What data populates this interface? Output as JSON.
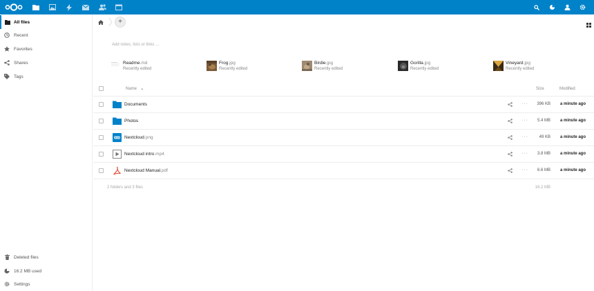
{
  "header": {
    "apps": [
      {
        "icon": "files-icon",
        "active": true
      },
      {
        "icon": "photos-icon",
        "active": false
      },
      {
        "icon": "activity-icon",
        "active": false
      },
      {
        "icon": "mail-icon",
        "active": false
      },
      {
        "icon": "contacts-icon",
        "active": false
      },
      {
        "icon": "calendar-icon",
        "active": false
      }
    ],
    "brand_color": "#0082c9"
  },
  "sidebar": {
    "items": [
      {
        "label": "All files",
        "icon": "folder-icon",
        "active": true
      },
      {
        "label": "Recent",
        "icon": "clock-icon"
      },
      {
        "label": "Favorites",
        "icon": "star-icon"
      },
      {
        "label": "Shares",
        "icon": "share-icon"
      },
      {
        "label": "Tags",
        "icon": "tag-icon"
      }
    ],
    "bottom": [
      {
        "label": "Deleted files",
        "icon": "trash-icon"
      },
      {
        "label": "16.2 MB used",
        "icon": "quota-pie-icon"
      },
      {
        "label": "Settings",
        "icon": "gear-icon"
      }
    ]
  },
  "main": {
    "add_label": "+",
    "notes_placeholder": "Add notes, lists or links …",
    "recent": [
      {
        "base": "Readme",
        "ext": ".md",
        "sub": "Recently edited"
      },
      {
        "base": "Frog",
        "ext": ".jpg",
        "sub": "Recently edited"
      },
      {
        "base": "Birdie",
        "ext": ".jpg",
        "sub": "Recently edited"
      },
      {
        "base": "Gorilla",
        "ext": ".jpg",
        "sub": "Recently edited"
      },
      {
        "base": "Vineyard",
        "ext": ".jpg",
        "sub": "Recently edited"
      }
    ],
    "table": {
      "col_name": "Name",
      "sort_indicator": "▲",
      "col_size": "Size",
      "col_modified": "Modified",
      "rows": [
        {
          "base": "Documents",
          "ext": "",
          "size": "396 KB",
          "modified": "a minute ago",
          "icon": "folder-icon"
        },
        {
          "base": "Photos",
          "ext": "",
          "size": "5.4 MB",
          "modified": "a minute ago",
          "icon": "folder-icon"
        },
        {
          "base": "Nextcloud",
          "ext": ".png",
          "size": "49 KB",
          "modified": "a minute ago",
          "icon": "image-icon"
        },
        {
          "base": "Nextcloud intro",
          "ext": ".mp4",
          "size": "3.8 MB",
          "modified": "a minute ago",
          "icon": "video-icon"
        },
        {
          "base": "Nextcloud Manual",
          "ext": ".pdf",
          "size": "6.6 MB",
          "modified": "a minute ago",
          "icon": "pdf-icon"
        }
      ],
      "more_label": "···",
      "summary_count": "2 folders and 3 files",
      "summary_size": "16.2 MB"
    }
  }
}
